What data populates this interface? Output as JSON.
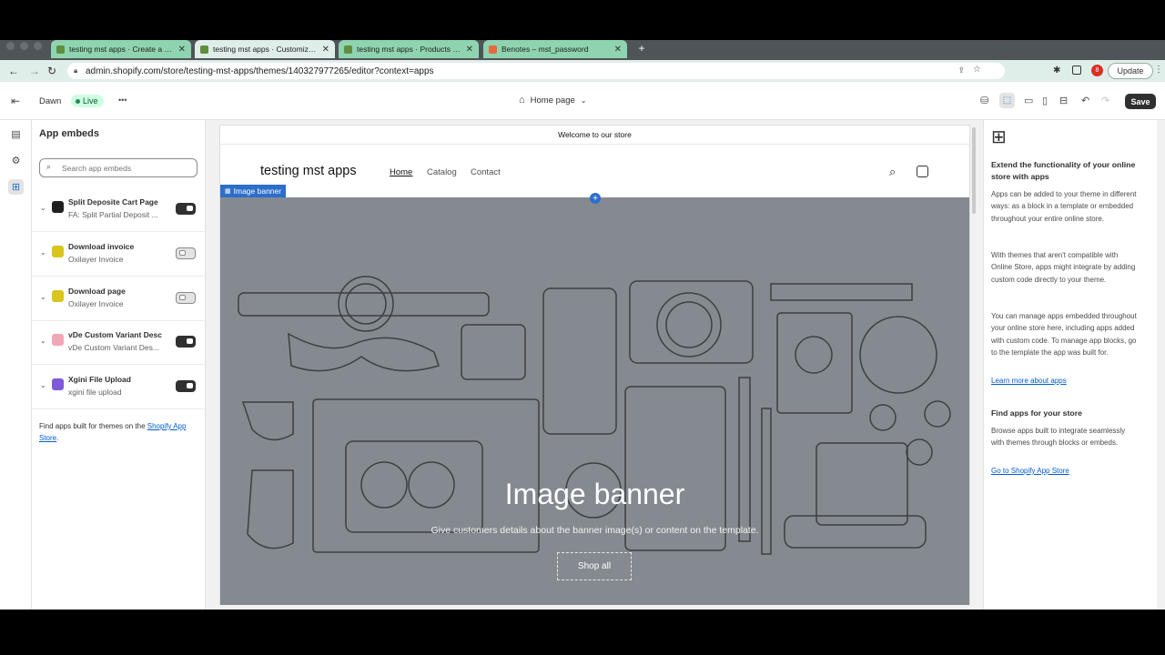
{
  "browser": {
    "tabs": [
      {
        "title": "testing mst apps · Create a Pa",
        "active": false,
        "color": "#8fd4b0"
      },
      {
        "title": "testing mst apps · Customize D",
        "active": true,
        "color": "#e0eee9"
      },
      {
        "title": "testing mst apps · Products · A",
        "active": false,
        "color": "#8fd4b0"
      },
      {
        "title": "Benotes – mst_password",
        "active": false,
        "color": "#8fd4b0"
      }
    ],
    "new_tab": "+",
    "url": "admin.shopify.com/store/testing-mst-apps/themes/140327977265/editor?context=apps",
    "update_label": "Update",
    "profile_badge": "8"
  },
  "topbar": {
    "theme_name": "Dawn",
    "live_label": "Live",
    "more": "•••",
    "page_selector": "Home page",
    "save_label": "Save"
  },
  "sidebar": {
    "title": "App embeds",
    "search_placeholder": "Search app embeds",
    "embeds": [
      {
        "name": "Split Deposite Cart Page",
        "subtitle": "FA: Split Partial Deposit ...",
        "enabled": true,
        "icon_color": "#1f1f1f"
      },
      {
        "name": "Download invoice",
        "subtitle": "Oxilayer Invoice",
        "enabled": false,
        "icon_color": "#d8c51e"
      },
      {
        "name": "Download page",
        "subtitle": "Oxilayer Invoice",
        "enabled": false,
        "icon_color": "#d8c51e"
      },
      {
        "name": "vDe Custom Variant Desc",
        "subtitle": "vDe Custom Variant Des...",
        "enabled": true,
        "icon_color": "#f1a7b5"
      },
      {
        "name": "Xgini File Upload",
        "subtitle": "xgini file upload",
        "enabled": true,
        "icon_color": "#7f5ad6"
      }
    ],
    "find_apps_prefix": "Find apps built for themes on the ",
    "find_apps_link": "Shopify App Store",
    "find_apps_suffix": "."
  },
  "preview": {
    "announcement": "Welcome to our store",
    "store_name": "testing mst apps",
    "nav": [
      "Home",
      "Catalog",
      "Contact"
    ],
    "banner_tag": "Image banner",
    "banner_heading": "Image banner",
    "banner_text": "Give customers details about the banner image(s) or content on the template.",
    "banner_button": "Shop all"
  },
  "right_panel": {
    "heading": "Extend the functionality of your online store with apps",
    "p1": "Apps can be added to your theme in different ways: as a block in a template or embedded throughout your entire online store.",
    "p2": "With themes that aren't compatible with Online Store, apps might integrate by adding custom code directly to your theme.",
    "p3": "You can manage apps embedded throughout your online store here, including apps added with custom code. To manage app blocks, go to the template the app was built for.",
    "learn_link": "Learn more about apps",
    "heading2": "Find apps for your store",
    "p4": "Browse apps built to integrate seamlessly with themes through blocks or embeds.",
    "store_link": "Go to Shopify App Store"
  },
  "colors": {
    "accent": "#2c6ecb",
    "banner_bg": "#848a8f",
    "save_bg": "#303030"
  }
}
